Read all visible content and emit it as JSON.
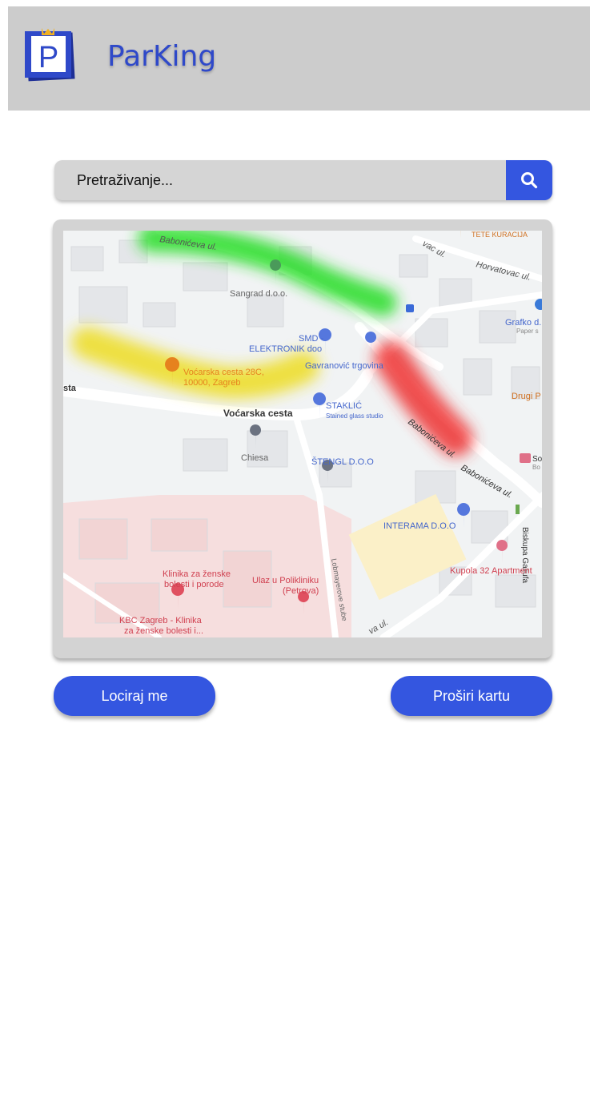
{
  "header": {
    "logo_letter": "P",
    "title": "ParKing"
  },
  "search": {
    "placeholder": "Pretraživanje...",
    "icon": "search-icon"
  },
  "map": {
    "labels": {
      "babonic_top": "Babonićeva ul.",
      "horvatovac": "Horvatovac ul.",
      "vac": "vac ul.",
      "tete": "TETE KURACIJA",
      "sangrad": "Sangrad d.o.o.",
      "grafko": "Grafko d.",
      "paper": "Paper s",
      "smd1": "SMD -",
      "smd2": "ELEKTRONIK doo",
      "gavranovic": "Gavranović trgovina",
      "vocarska_pin1": "Voćarska cesta 28C,",
      "vocarska_pin2": "10000, Zagreb",
      "sta": "sta",
      "drugi": "Drugi P",
      "vocarska": "Voćarska cesta",
      "staklic": "STAKLIĆ",
      "stained": "Stained glass studio",
      "babonic_mid": "Babonićeva ul.",
      "babonic_right": "Babonićeva ul.",
      "chiesa": "Chiesa",
      "stengl": "ŠTENGL D.O.O",
      "so": "So",
      "bo": "Bo",
      "interama": "INTERAMA D.O.O",
      "biskupa": "Biskupa Galjufa",
      "klinika1": "Klinika za ženske",
      "klinika2": "bolesti i porode",
      "ulaz1": "Ulaz u Polikliniku",
      "ulaz2": "(Petrova)",
      "kupola": "Kupola 32 Apartment",
      "lobmayerove": "Lobmayerove stube",
      "kbc1": "KBC Zagreb - Klinika",
      "kbc2": "za ženske bolesti i...",
      "va": "va ul."
    },
    "heat_colors": {
      "available": "#22dd22",
      "moderate": "#eedd22",
      "full": "#ee3333"
    }
  },
  "buttons": {
    "locate": "Lociraj me",
    "expand": "Proširi kartu"
  },
  "colors": {
    "accent": "#3456e0",
    "header_bg": "#cccccc",
    "title": "#2f49c9"
  }
}
